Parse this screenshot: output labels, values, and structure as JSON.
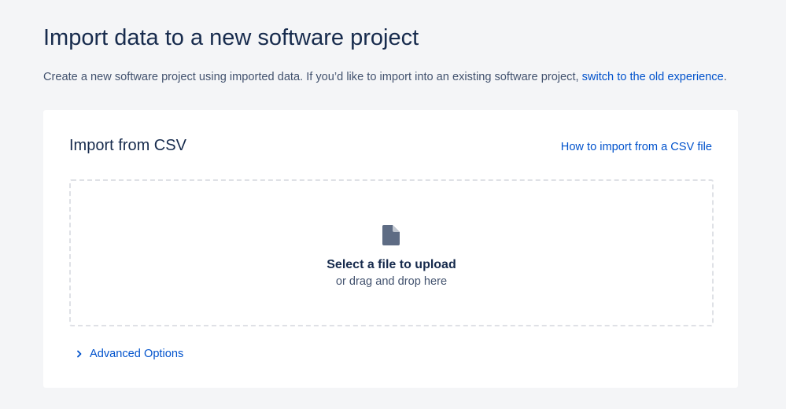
{
  "header": {
    "title": "Import data to a new software project",
    "subtitle_text": "Create a new software project using imported data. If you’d like to import into an existing software project, ",
    "subtitle_link": "switch to the old experience",
    "subtitle_end": "."
  },
  "card": {
    "title": "Import from CSV",
    "help_link": "How to import from a CSV file",
    "dropzone": {
      "primary": "Select a file to upload",
      "secondary": "or drag and drop here",
      "icon": "file-icon"
    },
    "advanced_options_label": "Advanced Options",
    "advanced_icon": "chevron-right-icon"
  },
  "colors": {
    "background": "#f4f5f7",
    "card": "#ffffff",
    "text_primary": "#172b4d",
    "text_secondary": "#42526e",
    "link": "#0052cc",
    "dropzone_border": "#dfe1e6",
    "icon": "#5e6c84"
  }
}
